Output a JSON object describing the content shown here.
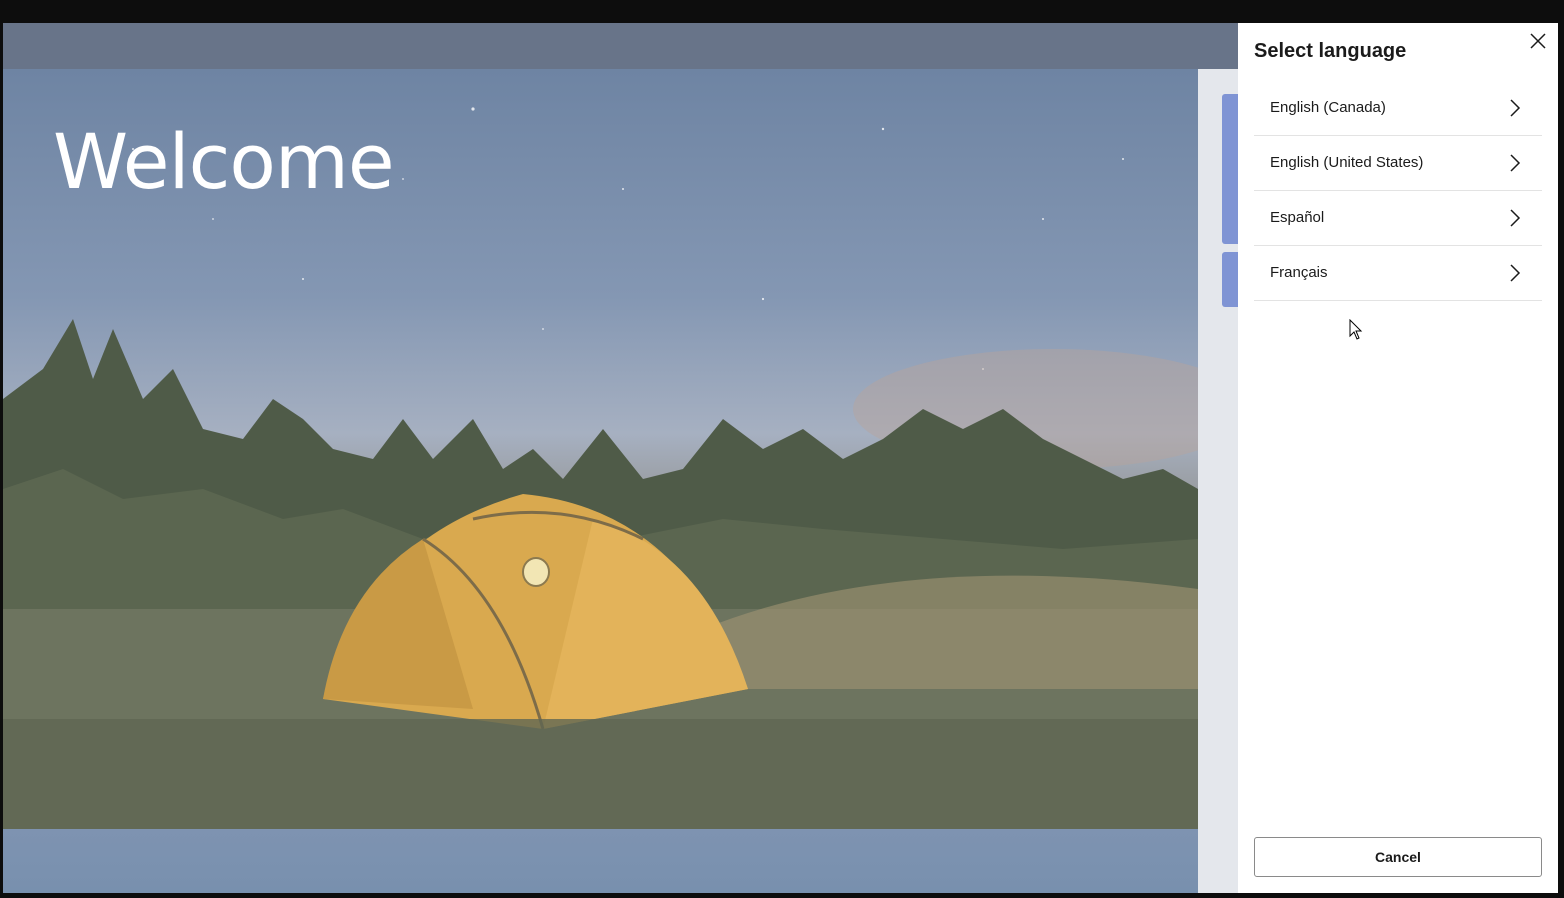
{
  "hero": {
    "heading": "Welcome"
  },
  "language_panel": {
    "title": "Select language",
    "close_icon": "close-icon",
    "languages": [
      {
        "label": "English (Canada)"
      },
      {
        "label": "English (United States)"
      },
      {
        "label": "Español"
      },
      {
        "label": "Français"
      }
    ],
    "cancel_label": "Cancel"
  },
  "colors": {
    "overlay": "#687489",
    "accent": "#7f94d4",
    "tent": "#d9a94f"
  }
}
